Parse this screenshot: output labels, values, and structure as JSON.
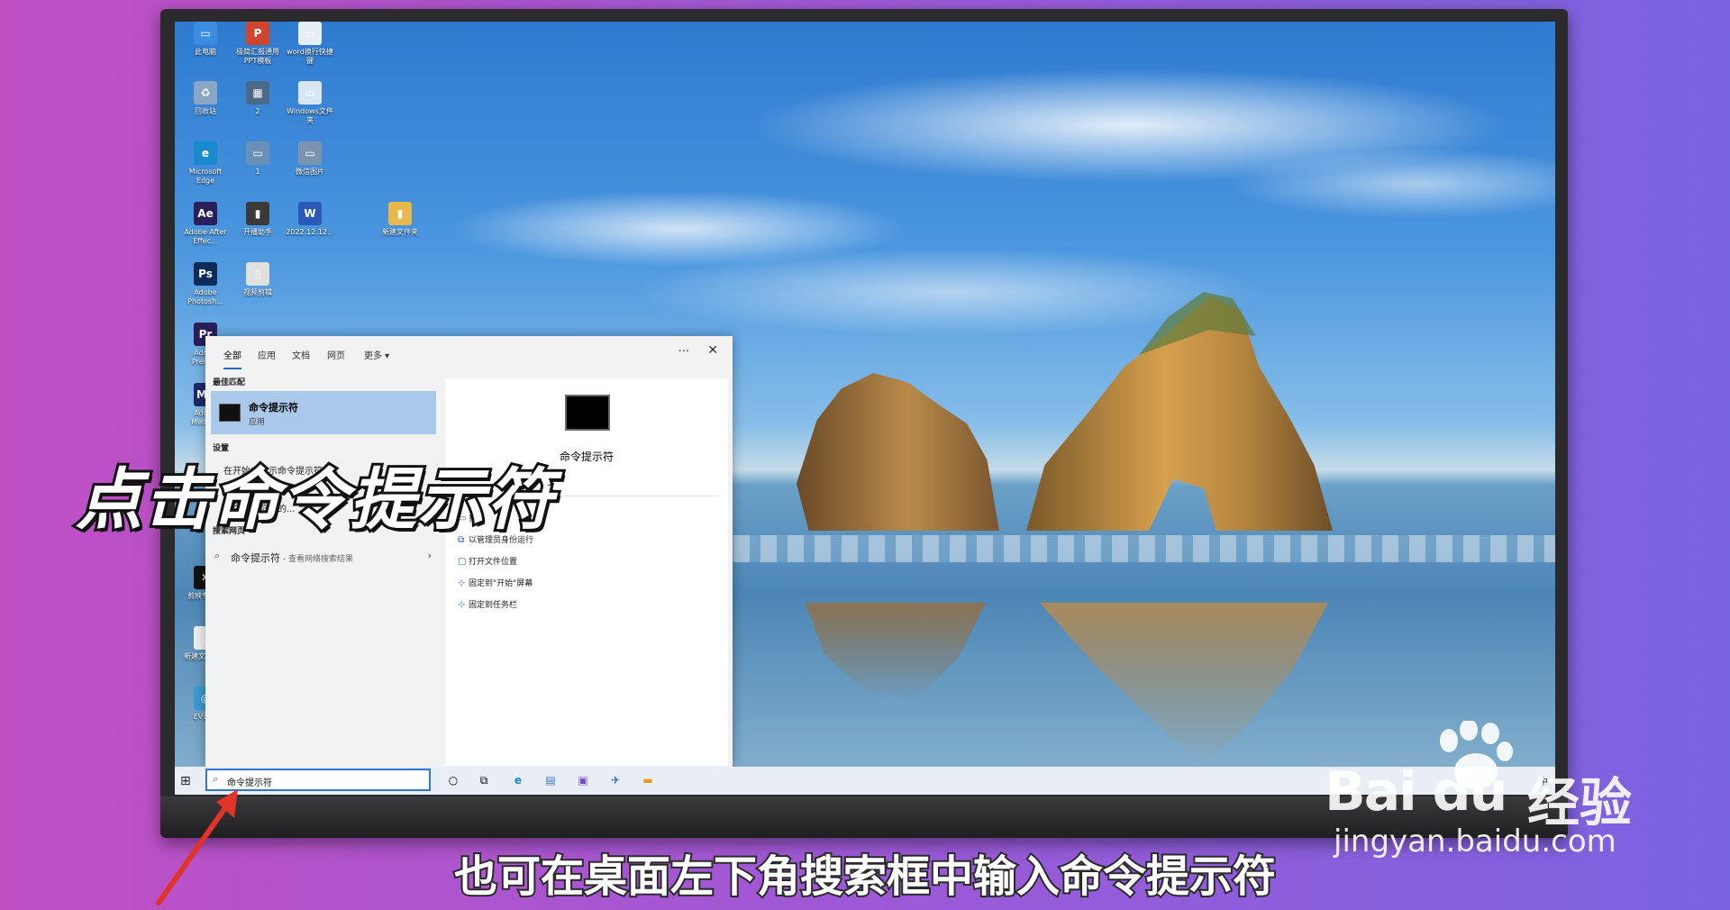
{
  "desktop": {
    "icons": [
      {
        "label": "此电脑",
        "glyph": "▭",
        "color": "#3a8de0"
      },
      {
        "label": "极简汇报通用PPT模板",
        "glyph": "P",
        "color": "#d0452b"
      },
      {
        "label": "word换行快捷键",
        "glyph": "▭",
        "color": "#e8eef6"
      },
      {
        "label": "回收站",
        "glyph": "♻",
        "color": "#8aa6c4"
      },
      {
        "label": "2",
        "glyph": "▦",
        "color": "#4a6a88"
      },
      {
        "label": "Windows文件夹",
        "glyph": "▭",
        "color": "#d8e6f2"
      },
      {
        "label": "Microsoft Edge",
        "glyph": "e",
        "color": "#1a8ad0"
      },
      {
        "label": "1",
        "glyph": "▭",
        "color": "#6a90b8"
      },
      {
        "label": "微信图片",
        "glyph": "▭",
        "color": "#7a94b0"
      },
      {
        "label": "Adobe After Effec...",
        "glyph": "Ae",
        "color": "#2a1f5a"
      },
      {
        "label": "开播助手",
        "glyph": "▮",
        "color": "#3a3a3a"
      },
      {
        "label": "2022.12.12...",
        "glyph": "W",
        "color": "#2a5ab8"
      },
      {
        "label": "新建文件夹",
        "glyph": "▮",
        "color": "#e8b84a"
      },
      {
        "label": "Adobe Photosh...",
        "glyph": "Ps",
        "color": "#0a2a5a"
      },
      {
        "label": "视频剪辑",
        "glyph": "▯",
        "color": "#e0e0e0"
      },
      {
        "label": "Adobe Premi...",
        "glyph": "Pr",
        "color": "#2a1f5a"
      },
      {
        "label": "Adobe Media...",
        "glyph": "Me",
        "color": "#1f2a6a"
      },
      {
        "label": "剪映专业版",
        "glyph": "✕",
        "color": "#111"
      },
      {
        "label": "新建文本文档",
        "glyph": "▯",
        "color": "#f0f0f0"
      },
      {
        "label": "EV录屏",
        "glyph": "◎",
        "color": "#3a9ad0"
      }
    ]
  },
  "search_panel": {
    "tabs": [
      "全部",
      "应用",
      "文档",
      "网页",
      "更多 ▾"
    ],
    "more_icon": "···",
    "close_icon": "✕",
    "best_match_header": "最佳匹配",
    "best_match": {
      "title": "命令提示符",
      "subtitle": "应用"
    },
    "settings_header": "设置",
    "settings_rows": [
      "在开始中显示命令提示符",
      "命令提示符中的..."
    ],
    "web_header": "搜索网页",
    "web_row": {
      "text": "命令提示符",
      "hint": " - 查看网络搜索结果",
      "chevron": "›"
    },
    "preview": {
      "title": "命令提示符",
      "actions": [
        {
          "icon": "▭",
          "label": "打开"
        },
        {
          "icon": "⧉",
          "label": "以管理员身份运行"
        },
        {
          "icon": "▢",
          "label": "打开文件位置"
        },
        {
          "icon": "⊹",
          "label": "固定到\"开始\"屏幕"
        },
        {
          "icon": "⊹",
          "label": "固定到任务栏"
        }
      ]
    }
  },
  "taskbar": {
    "start_glyph": "⊞",
    "search_value": "命令提示符",
    "apps": [
      "○",
      "⧉",
      "e",
      "▤",
      "▣",
      "✈",
      "▬"
    ],
    "tray_text": "中"
  },
  "overlay": {
    "caption": "点击命令提示符",
    "subtitle": "也可在桌面左下角搜索框中输入命令提示符"
  },
  "watermark": {
    "logo": "Bai du",
    "cn": "经验",
    "url": "jingyan.baidu.com"
  }
}
